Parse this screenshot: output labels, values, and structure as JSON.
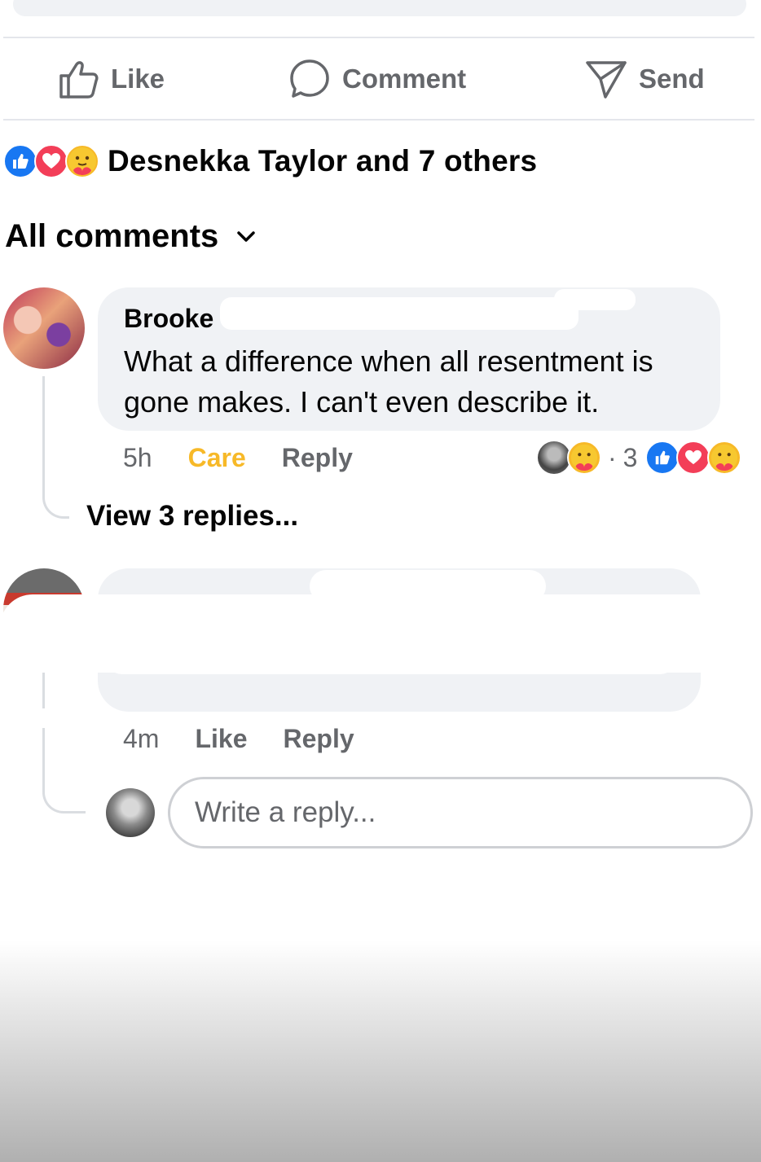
{
  "actions": {
    "like": "Like",
    "comment": "Comment",
    "send": "Send"
  },
  "reactions_summary": {
    "icons": [
      "like-icon",
      "love-icon",
      "care-icon"
    ],
    "names": "Desnekka Taylor and 7 others"
  },
  "filter": {
    "label": "All comments"
  },
  "comments": [
    {
      "author": "Brooke",
      "text": "What a difference when all resentment is gone makes. I can't even describe it.",
      "time": "5h",
      "reaction_label": "Care",
      "reply_label": "Reply",
      "reaction_count": "3",
      "view_replies": "View 3 replies..."
    },
    {
      "time": "4m",
      "like_label": "Like",
      "reply_label": "Reply"
    }
  ],
  "reply_box": {
    "placeholder": "Write a reply..."
  },
  "colors": {
    "like_blue": "#1877f2",
    "love_red": "#f33e58",
    "care_yellow": "#f7b928",
    "care_text": "#f7b928",
    "muted": "#65676b",
    "bubble": "#f0f2f5"
  }
}
